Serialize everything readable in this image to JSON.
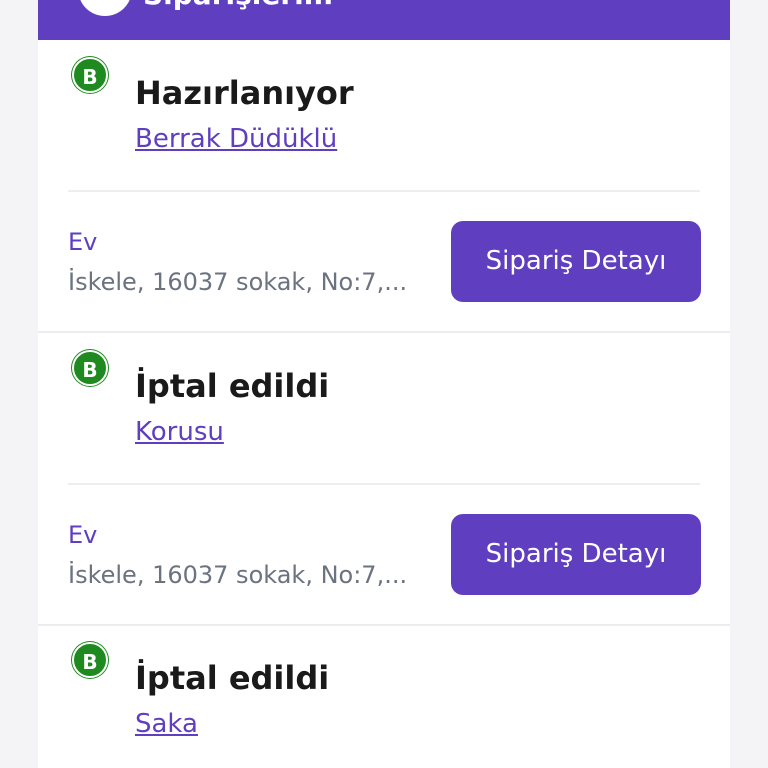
{
  "header": {
    "title": "Siparişlerim"
  },
  "orders": [
    {
      "badge": "B",
      "status": "Hazırlanıyor",
      "store": "Berrak Düdüklü",
      "address_label": "Ev",
      "address": "İskele, 16037 sokak, No:7,...",
      "button_label": "Sipariş Detayı"
    },
    {
      "badge": "B",
      "status": "İptal edildi",
      "store": "Korusu",
      "address_label": "Ev",
      "address": "İskele, 16037 sokak, No:7,...",
      "button_label": "Sipariş Detayı"
    },
    {
      "badge": "B",
      "status": "İptal edildi",
      "store": "Saka"
    }
  ],
  "colors": {
    "brand": "#5f3fbf",
    "badge": "#1f8a1f",
    "muted": "#6b7280"
  },
  "icons": {
    "store_badge": "store-logo-icon"
  }
}
